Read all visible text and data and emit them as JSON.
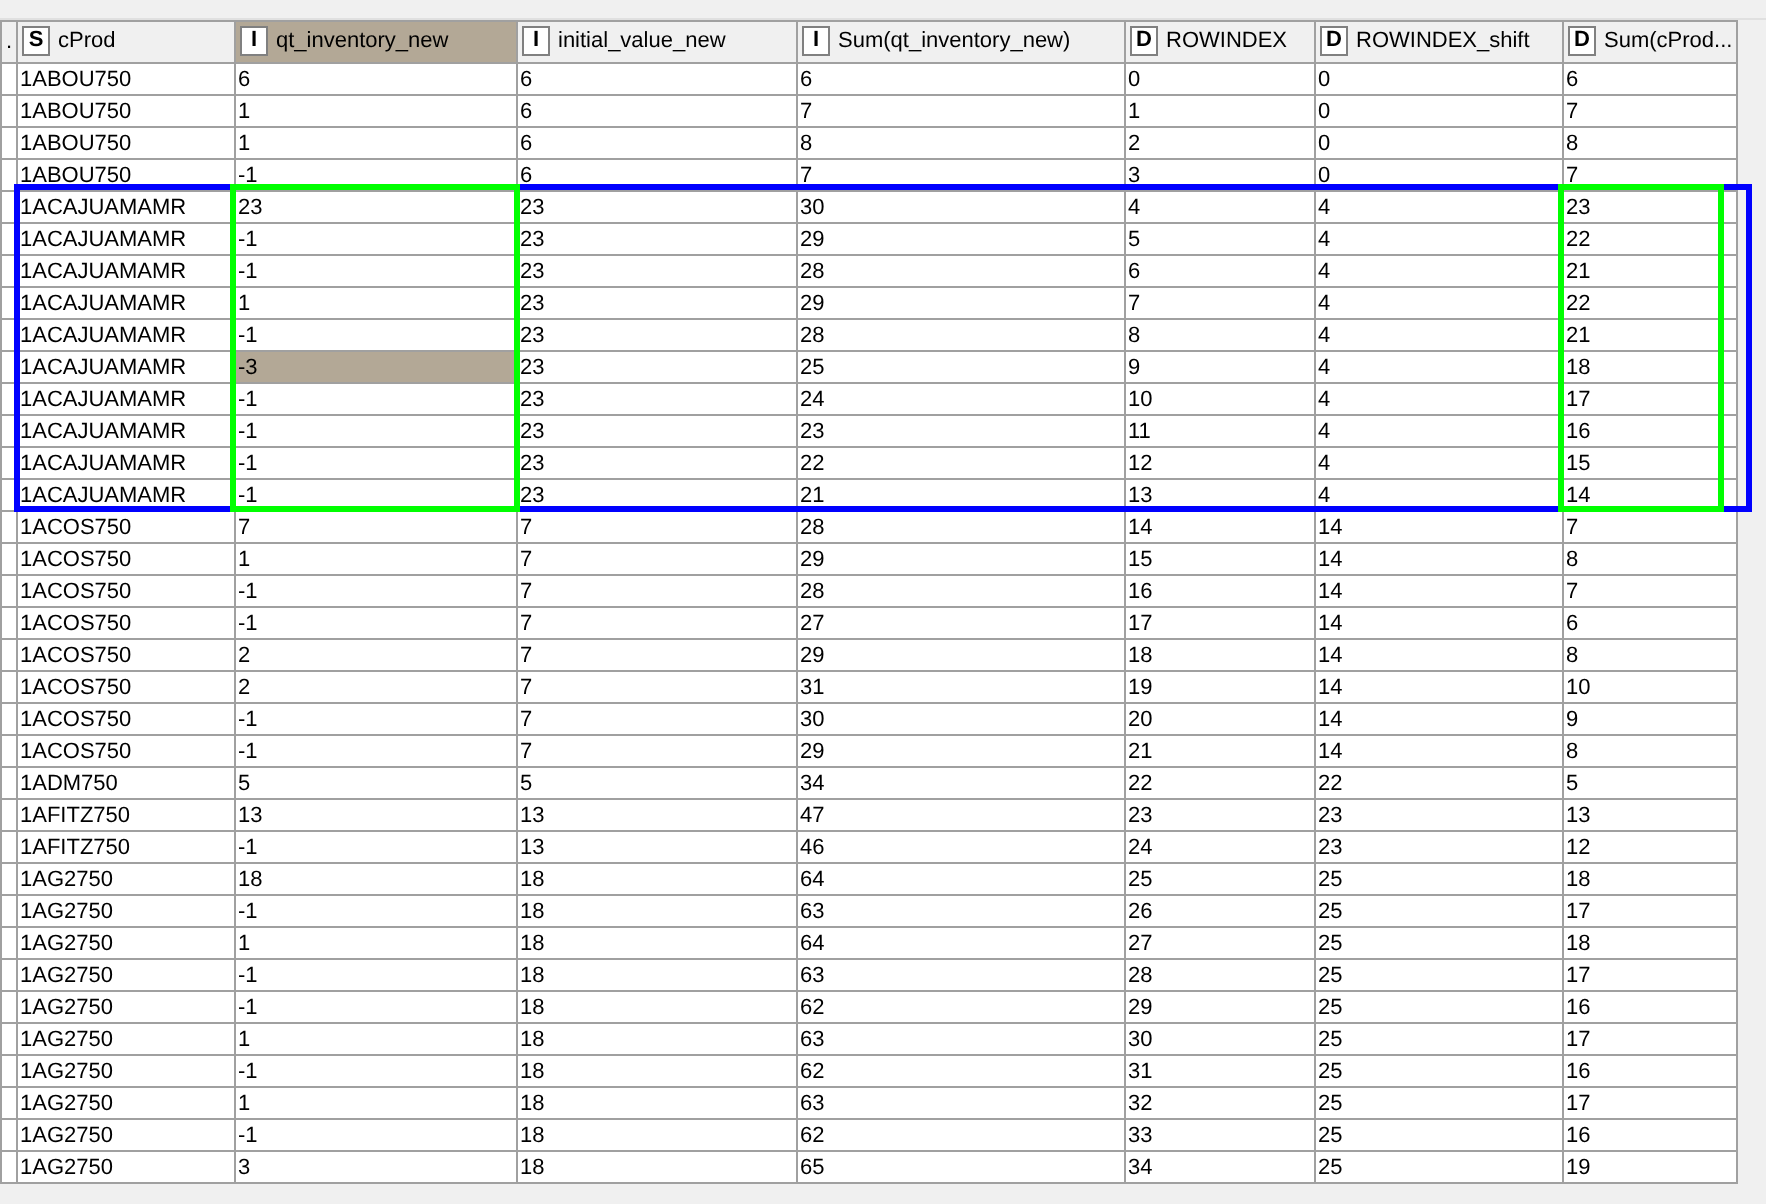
{
  "columns": [
    {
      "label": ".",
      "selected": false,
      "outlined": false
    },
    {
      "label": "cProd",
      "type_letter": "S",
      "selected": false,
      "outlined": false
    },
    {
      "label": "qt_inventory_new",
      "type_letter": "I",
      "selected": true,
      "outlined": true
    },
    {
      "label": "initial_value_new",
      "type_letter": "I",
      "selected": false,
      "outlined": false
    },
    {
      "label": "Sum(qt_inventory_new)",
      "type_letter": "I",
      "selected": false,
      "outlined": false
    },
    {
      "label": "ROWINDEX",
      "type_letter": "D",
      "selected": false,
      "outlined": false
    },
    {
      "label": "ROWINDEX_shift",
      "type_letter": "D",
      "selected": false,
      "outlined": false
    },
    {
      "label": "Sum(cProd...",
      "type_letter": "D",
      "selected": false,
      "outlined": true
    }
  ],
  "rows": [
    {
      "cells": [
        "1ABOU750",
        "6",
        "6",
        "6",
        "0",
        "0",
        "6"
      ],
      "selected": false,
      "outlined": false
    },
    {
      "cells": [
        "1ABOU750",
        "1",
        "6",
        "7",
        "1",
        "0",
        "7"
      ],
      "selected": false,
      "outlined": false
    },
    {
      "cells": [
        "1ABOU750",
        "1",
        "6",
        "8",
        "2",
        "0",
        "8"
      ],
      "selected": false,
      "outlined": false
    },
    {
      "cells": [
        "1ABOU750",
        "-1",
        "6",
        "7",
        "3",
        "0",
        "7"
      ],
      "selected": false,
      "outlined": false
    },
    {
      "cells": [
        "1ACAJUAMAMR",
        "23",
        "23",
        "30",
        "4",
        "4",
        "23"
      ],
      "selected": false,
      "outlined": true
    },
    {
      "cells": [
        "1ACAJUAMAMR",
        "-1",
        "23",
        "29",
        "5",
        "4",
        "22"
      ],
      "selected": false,
      "outlined": true
    },
    {
      "cells": [
        "1ACAJUAMAMR",
        "-1",
        "23",
        "28",
        "6",
        "4",
        "21"
      ],
      "selected": false,
      "outlined": true
    },
    {
      "cells": [
        "1ACAJUAMAMR",
        "1",
        "23",
        "29",
        "7",
        "4",
        "22"
      ],
      "selected": false,
      "outlined": true
    },
    {
      "cells": [
        "1ACAJUAMAMR",
        "-1",
        "23",
        "28",
        "8",
        "4",
        "21"
      ],
      "selected": false,
      "outlined": true
    },
    {
      "cells": [
        "1ACAJUAMAMR",
        "-3",
        "23",
        "25",
        "9",
        "4",
        "18"
      ],
      "selected": true,
      "outlined": true
    },
    {
      "cells": [
        "1ACAJUAMAMR",
        "-1",
        "23",
        "24",
        "10",
        "4",
        "17"
      ],
      "selected": false,
      "outlined": true
    },
    {
      "cells": [
        "1ACAJUAMAMR",
        "-1",
        "23",
        "23",
        "11",
        "4",
        "16"
      ],
      "selected": false,
      "outlined": true
    },
    {
      "cells": [
        "1ACAJUAMAMR",
        "-1",
        "23",
        "22",
        "12",
        "4",
        "15"
      ],
      "selected": false,
      "outlined": true
    },
    {
      "cells": [
        "1ACAJUAMAMR",
        "-1",
        "23",
        "21",
        "13",
        "4",
        "14"
      ],
      "selected": false,
      "outlined": true
    },
    {
      "cells": [
        "1ACOS750",
        "7",
        "7",
        "28",
        "14",
        "14",
        "7"
      ],
      "selected": false,
      "outlined": false
    },
    {
      "cells": [
        "1ACOS750",
        "1",
        "7",
        "29",
        "15",
        "14",
        "8"
      ],
      "selected": false,
      "outlined": false
    },
    {
      "cells": [
        "1ACOS750",
        "-1",
        "7",
        "28",
        "16",
        "14",
        "7"
      ],
      "selected": false,
      "outlined": false
    },
    {
      "cells": [
        "1ACOS750",
        "-1",
        "7",
        "27",
        "17",
        "14",
        "6"
      ],
      "selected": false,
      "outlined": false
    },
    {
      "cells": [
        "1ACOS750",
        "2",
        "7",
        "29",
        "18",
        "14",
        "8"
      ],
      "selected": false,
      "outlined": false
    },
    {
      "cells": [
        "1ACOS750",
        "2",
        "7",
        "31",
        "19",
        "14",
        "10"
      ],
      "selected": false,
      "outlined": false
    },
    {
      "cells": [
        "1ACOS750",
        "-1",
        "7",
        "30",
        "20",
        "14",
        "9"
      ],
      "selected": false,
      "outlined": false
    },
    {
      "cells": [
        "1ACOS750",
        "-1",
        "7",
        "29",
        "21",
        "14",
        "8"
      ],
      "selected": false,
      "outlined": false
    },
    {
      "cells": [
        "1ADM750",
        "5",
        "5",
        "34",
        "22",
        "22",
        "5"
      ],
      "selected": false,
      "outlined": false
    },
    {
      "cells": [
        "1AFITZ750",
        "13",
        "13",
        "47",
        "23",
        "23",
        "13"
      ],
      "selected": false,
      "outlined": false
    },
    {
      "cells": [
        "1AFITZ750",
        "-1",
        "13",
        "46",
        "24",
        "23",
        "12"
      ],
      "selected": false,
      "outlined": false
    },
    {
      "cells": [
        "1AG2750",
        "18",
        "18",
        "64",
        "25",
        "25",
        "18"
      ],
      "selected": false,
      "outlined": false
    },
    {
      "cells": [
        "1AG2750",
        "-1",
        "18",
        "63",
        "26",
        "25",
        "17"
      ],
      "selected": false,
      "outlined": false
    },
    {
      "cells": [
        "1AG2750",
        "1",
        "18",
        "64",
        "27",
        "25",
        "18"
      ],
      "selected": false,
      "outlined": false
    },
    {
      "cells": [
        "1AG2750",
        "-1",
        "18",
        "63",
        "28",
        "25",
        "17"
      ],
      "selected": false,
      "outlined": false
    },
    {
      "cells": [
        "1AG2750",
        "-1",
        "18",
        "62",
        "29",
        "25",
        "16"
      ],
      "selected": false,
      "outlined": false
    },
    {
      "cells": [
        "1AG2750",
        "1",
        "18",
        "63",
        "30",
        "25",
        "17"
      ],
      "selected": false,
      "outlined": false
    },
    {
      "cells": [
        "1AG2750",
        "-1",
        "18",
        "62",
        "31",
        "25",
        "16"
      ],
      "selected": false,
      "outlined": false
    },
    {
      "cells": [
        "1AG2750",
        "1",
        "18",
        "63",
        "32",
        "25",
        "17"
      ],
      "selected": false,
      "outlined": false
    },
    {
      "cells": [
        "1AG2750",
        "-1",
        "18",
        "62",
        "33",
        "25",
        "16"
      ],
      "selected": false,
      "outlined": false
    },
    {
      "cells": [
        "1AG2750",
        "3",
        "18",
        "65",
        "34",
        "25",
        "19"
      ],
      "selected": false,
      "outlined": false
    }
  ]
}
